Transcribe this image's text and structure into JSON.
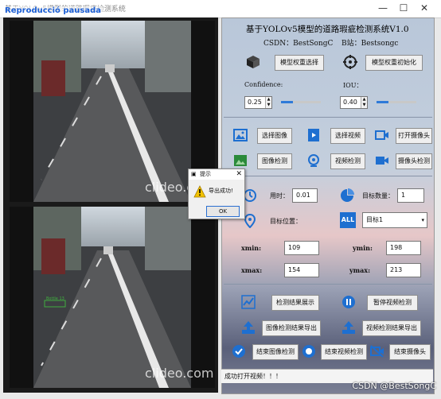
{
  "window": {
    "title": "基于YOLOv5模型的道路瑕疵检测系统",
    "overlay_label": "Reproducció pausada",
    "minimize": "—",
    "maximize": "☐",
    "close": "✕"
  },
  "video": {
    "watermark_top": "clideo.com",
    "watermark_bottom": "clideo.com",
    "detection_label": "Bottle 13"
  },
  "header": {
    "title": "基于YOLOv5模型的道路瑕疵检测系统V1.0",
    "csdn": "CSDN：BestSongC",
    "bilibili": "B站：Bestsongc"
  },
  "model": {
    "select_label": "模型权重选择",
    "init_label": "模型权重初始化"
  },
  "params": {
    "confidence_label": "Confidence:",
    "confidence_value": "0.25",
    "confidence_fraction": 0.3,
    "iou_label": "IOU：",
    "iou_value": "0.40",
    "iou_fraction": 0.3
  },
  "inputs": {
    "select_image": "选择图像",
    "select_video": "选择视频",
    "open_camera": "打开摄像头",
    "detect_image": "图像检测",
    "detect_video": "视频检测",
    "detect_camera": "摄像头检测"
  },
  "result": {
    "time_label": "用时：",
    "time_value": "0.01",
    "count_label": "目标数量：",
    "count_value": "1",
    "position_label": "目标位置：",
    "target_select": "目标1",
    "all_label": "ALL",
    "xmin_label": "xmin:",
    "xmin_value": "109",
    "ymin_label": "ymin:",
    "ymin_value": "198",
    "xmax_label": "xmax:",
    "xmax_value": "154",
    "ymax_label": "ymax:",
    "ymax_value": "213"
  },
  "actions": {
    "show_result": "检测结果展示",
    "pause_video": "暂停视频检测",
    "export_image": "图像检测结果导出",
    "export_video": "视频检测结果导出",
    "end_image": "结束图像检测",
    "end_video": "结束视频检测",
    "end_camera": "结束摄像头"
  },
  "status": {
    "text": "成功打开视频！！！"
  },
  "dialog": {
    "title": "提示",
    "message": "导出成功!",
    "ok": "OK"
  },
  "watermark_csdn": "CSDN @BestSongC",
  "colors": {
    "accent": "#2f7ad8",
    "panel_bg": "#c4cfdd"
  }
}
